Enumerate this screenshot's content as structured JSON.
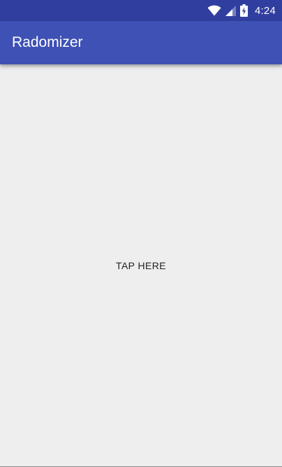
{
  "status_bar": {
    "time": "4:24",
    "color": "#303f9f",
    "icons": [
      "wifi-icon",
      "cellular-signal-icon",
      "battery-charging-icon"
    ]
  },
  "app_bar": {
    "title": "Radomizer",
    "color": "#3f51b5"
  },
  "main": {
    "tap_button_label": "TAP HERE",
    "background": "#eeeeee"
  }
}
